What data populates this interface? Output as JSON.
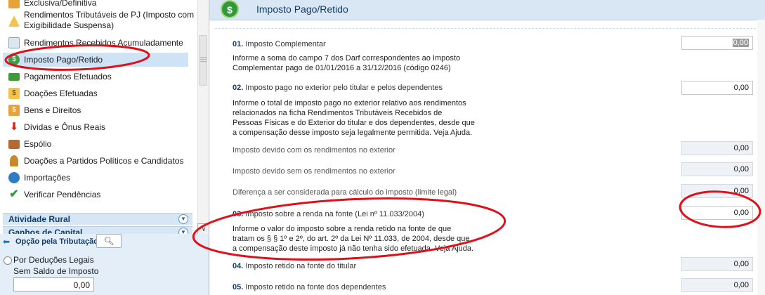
{
  "sidebar": {
    "items": [
      {
        "label": "Exclusiva/Definitiva",
        "icon": "money-bag-icon"
      },
      {
        "label": "Rendimentos Tributáveis de PJ (Imposto com",
        "label2": "Exigibilidade Suspensa)",
        "icon": "balance-warning-icon"
      },
      {
        "label": "Rendimentos Recebidos Acumuladamente",
        "icon": "magnifier-document-icon"
      },
      {
        "label": "Imposto Pago/Retido",
        "icon": "dollar-coin-icon"
      },
      {
        "label": "Pagamentos Efetuados",
        "icon": "cash-icon"
      },
      {
        "label": "Doações Efetuadas",
        "icon": "dollar-note-icon"
      },
      {
        "label": "Bens e Direitos",
        "icon": "dollar-bag-icon"
      },
      {
        "label": "Dívidas e Ônus Reais",
        "icon": "down-arrow-red-icon"
      },
      {
        "label": "Espólio",
        "icon": "briefcase-icon"
      },
      {
        "label": "Doações a Partidos Políticos e Candidatos",
        "icon": "ribbon-icon"
      },
      {
        "label": "Importações",
        "icon": "globe-icon"
      },
      {
        "label": "Verificar Pendências",
        "icon": "checkmark-icon"
      }
    ],
    "sections": [
      {
        "label": "Atividade Rural"
      },
      {
        "label": "Ganhos de Capital"
      }
    ],
    "options": {
      "title": "Opção pela Tributação:",
      "radio_label": "Por Deduções Legais",
      "saldo_label": "Sem Saldo de Imposto",
      "saldo_value": "0,00"
    }
  },
  "header": {
    "title": "Imposto Pago/Retido",
    "icon": "dollar-coin-icon"
  },
  "fields": [
    {
      "num": "01.",
      "label": "Imposto Complementar",
      "value": "0,00",
      "desc": [
        "Informe a soma do campo 7 dos Darf correspondentes ao Imposto",
        "Complementar pago de 01/01/2016 a 31/12/2016 (código 0246)"
      ]
    },
    {
      "num": "02.",
      "label": "Imposto pago no exterior pelo titular e pelos dependentes",
      "value": "0,00",
      "desc": [
        "Informe o total de imposto pago no exterior relativo aos rendimentos",
        "relacionados na ficha Rendimentos Tributáveis Recebidos de",
        "Pessoas Físicas e do Exterior do titular e dos dependentes, desde que",
        "a compensação desse imposto seja legalmente permitida. Veja Ajuda."
      ]
    },
    {
      "num": "",
      "label": "Imposto devido com os rendimentos no exterior",
      "value": "0,00"
    },
    {
      "num": "",
      "label": "Imposto devido sem os rendimentos no exterior",
      "value": "0,00"
    },
    {
      "num": "",
      "label": "Diferença a ser considerada para cálculo do imposto (limite legal)",
      "value": "0,00"
    },
    {
      "num": "03.",
      "label": "Imposto sobre a renda na fonte (Lei nº 11.033/2004)",
      "value": "0,00",
      "desc": [
        "Informe o valor do imposto sobre a renda retido na fonte de que",
        "tratam os § § 1º e 2º, do art. 2º da Lei Nº 11.033, de 2004, desde que",
        "a compensação deste imposto já não tenha sido efetuada. Veja Ajuda."
      ]
    },
    {
      "num": "04.",
      "label": "Imposto retido na fonte do titular",
      "value": "0,00"
    },
    {
      "num": "05.",
      "label": "Imposto retido na fonte dos dependentes",
      "value": "0,00"
    }
  ],
  "colors": {
    "accent": "#123c6b",
    "annotation": "#e0101a",
    "selected": "#cfe3f6"
  }
}
